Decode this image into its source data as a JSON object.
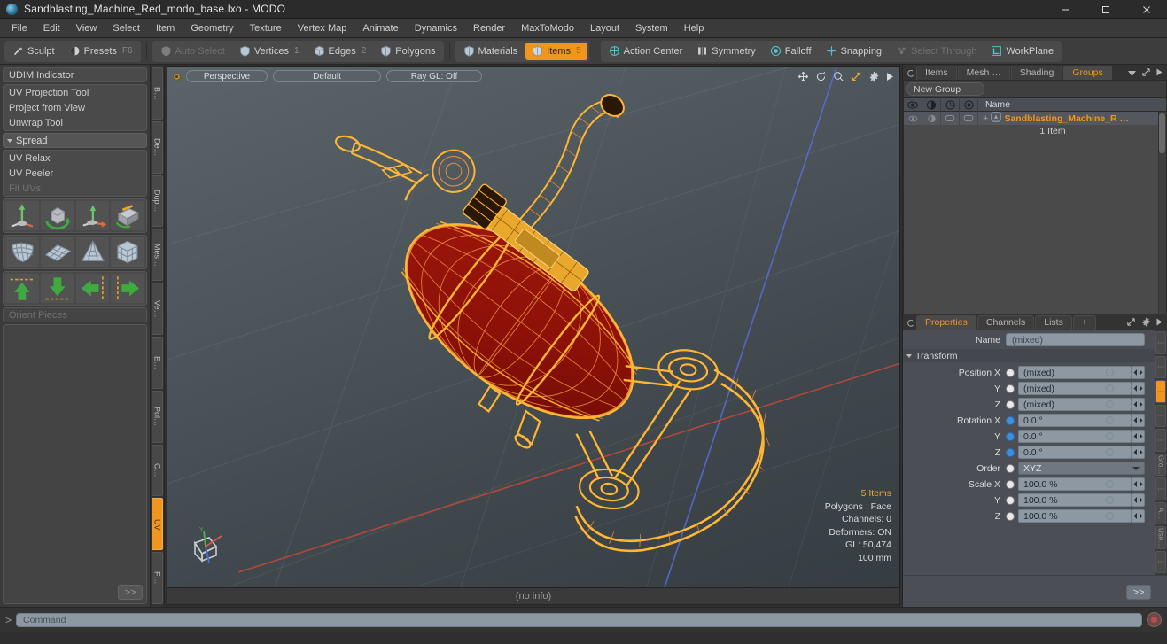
{
  "window": {
    "title": "Sandblasting_Machine_Red_modo_base.lxo - MODO",
    "app_icon": "modo-sphere-icon",
    "controls": {
      "minimize": "minimize-icon",
      "maximize": "maximize-icon",
      "close": "close-icon"
    }
  },
  "menubar": {
    "items": [
      "File",
      "Edit",
      "View",
      "Select",
      "Item",
      "Geometry",
      "Texture",
      "Vertex Map",
      "Animate",
      "Dynamics",
      "Render",
      "MaxToModo",
      "Layout",
      "System",
      "Help"
    ]
  },
  "toolbar": {
    "groups": [
      {
        "buttons": [
          {
            "label": "Sculpt",
            "icon": "sculpt-brush-icon",
            "shortcut": "",
            "state": "normal"
          },
          {
            "label": "Presets",
            "icon": "presets-sphere-icon",
            "shortcut": "F6",
            "state": "normal"
          }
        ]
      },
      {
        "buttons": [
          {
            "label": "Auto Select",
            "icon": "shield-gray-icon",
            "shortcut": "",
            "state": "disabled"
          },
          {
            "label": "Vertices",
            "icon": "shield-blue-icon",
            "shortcut": "1",
            "state": "normal"
          },
          {
            "label": "Edges",
            "icon": "cube-blue-icon",
            "shortcut": "2",
            "state": "normal"
          },
          {
            "label": "Polygons",
            "icon": "shield-blue-icon",
            "shortcut": "",
            "state": "normal"
          }
        ]
      },
      {
        "buttons": [
          {
            "label": "Materials",
            "icon": "shield-blue-icon",
            "shortcut": "",
            "state": "normal"
          },
          {
            "label": "Items",
            "icon": "shield-orange-icon",
            "shortcut": "5",
            "state": "active"
          }
        ]
      },
      {
        "buttons": [
          {
            "label": "Action Center",
            "icon": "target-icon",
            "shortcut": "",
            "state": "normal"
          },
          {
            "label": "Symmetry",
            "icon": "symmetry-bars-icon",
            "shortcut": "",
            "state": "normal"
          },
          {
            "label": "Falloff",
            "icon": "falloff-circle-icon",
            "shortcut": "",
            "state": "normal"
          },
          {
            "label": "Snapping",
            "icon": "snapping-cross-icon",
            "shortcut": "",
            "state": "normal"
          },
          {
            "label": "Select Through",
            "icon": "select-through-icon",
            "shortcut": "",
            "state": "disabled"
          },
          {
            "label": "WorkPlane",
            "icon": "workplane-icon",
            "shortcut": "",
            "state": "normal"
          }
        ]
      }
    ]
  },
  "left_toolbox": {
    "rows": [
      {
        "label": "UDIM Indicator",
        "style": "single",
        "state": "normal"
      }
    ],
    "group_a": [
      {
        "label": "UV Projection Tool",
        "state": "normal"
      },
      {
        "label": "Project from View",
        "state": "normal"
      },
      {
        "label": "Unwrap Tool",
        "state": "normal"
      }
    ],
    "section": {
      "label": "Spread",
      "icon": "disclosure-triangle-icon"
    },
    "group_b": [
      {
        "label": "UV Relax",
        "state": "normal"
      },
      {
        "label": "UV Peeler",
        "state": "normal"
      },
      {
        "label": "Fit UVs",
        "state": "disabled"
      }
    ],
    "icon_rows": [
      [
        "uv-projection-axis-icon",
        "uv-cube-rotate-icon",
        "uv-axis-arrows-icon",
        "uv-peel-icon"
      ],
      [
        "uv-sphere-mesh-icon",
        "uv-plane-mesh-icon",
        "uv-cone-mesh-icon",
        "uv-box-mesh-icon"
      ],
      [
        "move-up-icon",
        "move-down-icon",
        "move-left-icon",
        "move-right-icon"
      ]
    ],
    "orient_field": {
      "label": "Orient Pieces",
      "state": "disabled"
    },
    "more_button": ">>",
    "vertical_tabs": [
      {
        "label": "B…",
        "active": false
      },
      {
        "label": "De…",
        "active": false
      },
      {
        "label": "Dup…",
        "active": false
      },
      {
        "label": "Mes…",
        "active": false
      },
      {
        "label": "Ve…",
        "active": false
      },
      {
        "label": "E…",
        "active": false
      },
      {
        "label": "Pol…",
        "active": false
      },
      {
        "label": "C…",
        "active": false
      },
      {
        "label": "UV",
        "active": true
      },
      {
        "label": "F…",
        "active": false
      }
    ]
  },
  "viewport": {
    "indicator": "viewport-active-dot",
    "pills": [
      "Perspective",
      "Default",
      "Ray GL: Off"
    ],
    "icons": [
      "pan-icon",
      "rotate-icon",
      "zoom-icon",
      "fit-icon",
      "gear-icon",
      "play-arrow-icon"
    ],
    "stats": {
      "items": "5 Items",
      "polygons": "Polygons : Face",
      "channels": "Channels: 0",
      "deformers": "Deformers: ON",
      "gl": "GL: 50,474",
      "scale": "100 mm"
    },
    "gizmo": {
      "x": "X",
      "y": "Y",
      "z": "Z"
    },
    "status": "(no info)",
    "model": {
      "name": "sandblasting-machine-red",
      "body_color": "#8c1008",
      "wire_color": "#f0a020",
      "selected_wire_color": "#ffb733"
    }
  },
  "groups_panel": {
    "tabs": [
      {
        "label": "Items",
        "active": false
      },
      {
        "label": "Mesh …",
        "active": false
      },
      {
        "label": "Shading",
        "active": false
      },
      {
        "label": "Groups",
        "active": true
      }
    ],
    "tab_overflow_icon": "chevron-down-icon",
    "expand_icon": "expand-arrows-icon",
    "more_icon": "play-arrow-icon",
    "new_group_button": "New Group",
    "columns": [
      "visibility-eye-icon",
      "render-icon",
      "lock-icon",
      "wireframe-icon",
      "Name"
    ],
    "rows": [
      {
        "name": "Sandblasting_Machine_R …",
        "icon": "group-icon",
        "sub": "1 Item",
        "expander": "+"
      }
    ]
  },
  "properties_panel": {
    "tabs": [
      {
        "label": "Properties",
        "active": true
      },
      {
        "label": "Channels",
        "active": false
      },
      {
        "label": "Lists",
        "active": false
      },
      {
        "label": "+",
        "active": false
      }
    ],
    "expand_icon": "expand-arrows-icon",
    "gear_icon": "gear-icon",
    "more_icon": "play-arrow-icon",
    "name_label": "Name",
    "name_value": "(mixed)",
    "section": {
      "label": "Transform",
      "icon": "disclosure-triangle-icon"
    },
    "fields": [
      {
        "label": "Position X",
        "value": "(mixed)",
        "radio": "off"
      },
      {
        "label": "Y",
        "value": "(mixed)",
        "radio": "off"
      },
      {
        "label": "Z",
        "value": "(mixed)",
        "radio": "off"
      },
      {
        "label": "Rotation X",
        "value": "0.0 °",
        "radio": "on"
      },
      {
        "label": "Y",
        "value": "0.0 °",
        "radio": "on"
      },
      {
        "label": "Z",
        "value": "0.0 °",
        "radio": "on"
      }
    ],
    "order": {
      "label": "Order",
      "value": "XYZ",
      "radio": "off"
    },
    "scale": [
      {
        "label": "Scale X",
        "value": "100.0 %",
        "radio": "off"
      },
      {
        "label": "Y",
        "value": "100.0 %",
        "radio": "off"
      },
      {
        "label": "Z",
        "value": "100.0 %",
        "radio": "off"
      }
    ],
    "more_button": ">>",
    "vertical_tabs": [
      {
        "label": "⋮",
        "active": false
      },
      {
        "label": "⋮",
        "active": false
      },
      {
        "label": "⋮",
        "active": true
      },
      {
        "label": "⋮",
        "active": false
      },
      {
        "label": "⋮",
        "active": false
      },
      {
        "label": "Gro…",
        "active": false
      },
      {
        "label": "⋮",
        "active": false
      },
      {
        "label": "A…",
        "active": false
      },
      {
        "label": "Use…",
        "active": false
      },
      {
        "label": "⋮",
        "active": false
      }
    ]
  },
  "command_bar": {
    "prompt": ">",
    "placeholder": "Command",
    "record_button": "record-icon"
  },
  "colors": {
    "accent_orange": "#f0951e",
    "panel_bg": "#3a3a3a",
    "field_bg": "#8d98a3",
    "viewport_bg": "#4d565b"
  }
}
